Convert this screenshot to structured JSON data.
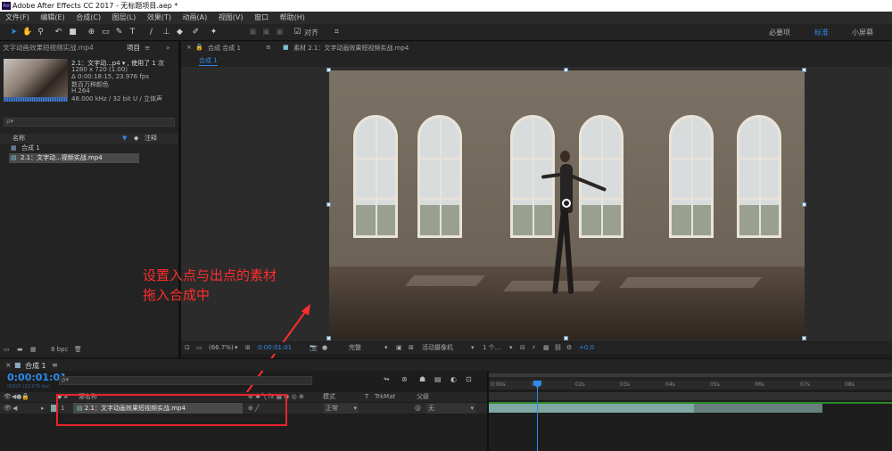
{
  "app": {
    "title": "Adobe After Effects CC 2017 - 无标题项目.aep *",
    "logo": "Ae"
  },
  "menu": [
    "文件(F)",
    "编辑(E)",
    "合成(C)",
    "图层(L)",
    "效果(T)",
    "动画(A)",
    "视图(V)",
    "窗口",
    "帮助(H)"
  ],
  "toolbar": {
    "align_label": "对齐",
    "workspaces": [
      "必要项",
      "标准",
      "小屏幕"
    ]
  },
  "project_panel": {
    "tab_left": "文字动画效果短视频实战.mp4",
    "tab_active": "项目",
    "file_name": "2.1：文字动...p4 ▾ , 使用了 1 次",
    "resolution": "1280 x 720 (1.00)",
    "duration": "Δ 0:00:18:15, 23.976 fps",
    "color": "数百万种颜色",
    "codec": "H.264",
    "audio": "48.000 kHz / 32 bit U / 立体声",
    "search_placeholder": "ρ▾",
    "col_name": "名称",
    "col_comment": "注释",
    "items": [
      "合成 1",
      "2.1：文字动...视频实战.mp4"
    ],
    "bpc": "8 bpc"
  },
  "composition_panel": {
    "tab_comp": "合成 合成 1",
    "tab_footage": "素材 2.1：文字动画效果短视频实战.mp4",
    "breadcrumb": "合成 1",
    "zoom": "(66.7%)",
    "timecode": "0:00:01:01",
    "resolution": "完整",
    "camera": "活动摄像机",
    "views": "1 个...",
    "exposure": "+0.0"
  },
  "annotation": {
    "line1": "设置入点与出点的素材",
    "line2": "拖入合成中",
    "color": "#ff2d2d"
  },
  "timeline": {
    "tab": "合成 1",
    "timecode": "0:00:01:01",
    "timecode_sub": "00025 (23.976 fps)",
    "search_placeholder": "ρ▾",
    "col_num": "#",
    "col_source": "源名称",
    "col_mode": "模式",
    "col_t": "T",
    "col_trkmat": "TrkMat",
    "col_parent": "父级",
    "layer": {
      "index": "1",
      "name": "2.1：文字动画效果短视频实战.mp4",
      "mode": "正常",
      "parent": "无"
    },
    "ruler_ticks": [
      "0:00s",
      "01s",
      "02s",
      "03s",
      "04s",
      "05s",
      "06s",
      "07s",
      "08s"
    ]
  },
  "colors": {
    "accent": "#2d8ceb",
    "highlight_box": "#e8242c",
    "layer_bar": "#7fa8a5"
  }
}
